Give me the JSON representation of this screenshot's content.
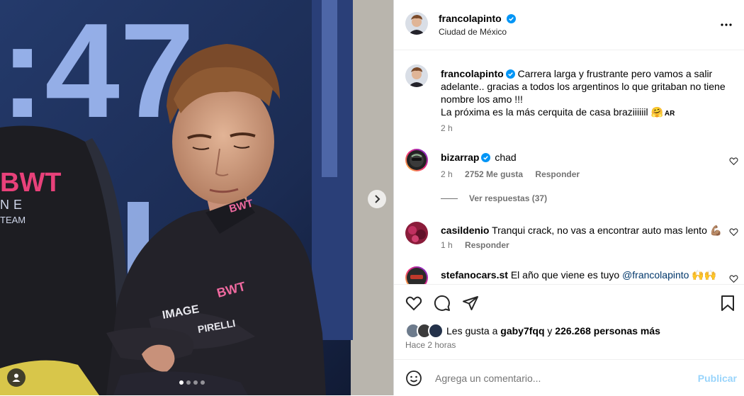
{
  "header": {
    "username": "francolapinto",
    "location": "Ciudad de México",
    "more_icon": "more-horizontal-icon"
  },
  "caption": {
    "username": "francolapinto",
    "line1": "Carrera larga y frustrante pero vamos a salir adelante.. gracias a todos los argentinos lo que gritaban no tiene nombre los amo !!!",
    "line2": "La próxima es la más cerquita de casa braziiiiiil 🤗",
    "flag": "AR",
    "time": "2 h"
  },
  "comments": [
    {
      "username": "bizarrap",
      "verified": true,
      "text": "chad",
      "time": "2 h",
      "likes": "2752 Me gusta",
      "reply": "Responder"
    },
    {
      "username": "casildenio",
      "verified": false,
      "text": "Tranqui crack, no vas a encontrar auto mas lento 💪🏽",
      "time": "1 h",
      "reply": "Responder"
    },
    {
      "username": "stefanocars.st",
      "verified": false,
      "text": "El año que viene es tuyo",
      "mention": "@francolapinto",
      "emoji": "🙌🙌"
    }
  ],
  "view_replies": "Ver respuestas (37)",
  "likes": {
    "prefix": "Les gusta a",
    "user": "gaby7fqq",
    "connector": "y",
    "count": "226.268 personas más"
  },
  "posted": "Hace 2 horas",
  "composer": {
    "placeholder": "Agrega un comentario...",
    "submit": "Publicar"
  },
  "photo": {
    "timer_text": ":47",
    "shirt_brand": "BWT",
    "next_icon": "chevron-right-icon",
    "dots": 4,
    "active_dot": 0
  },
  "colors": {
    "accent_blue": "#0095f6",
    "verified_blue": "#0095f6",
    "mention": "#00376b",
    "muted": "#737373",
    "border": "#dbdbdb"
  }
}
